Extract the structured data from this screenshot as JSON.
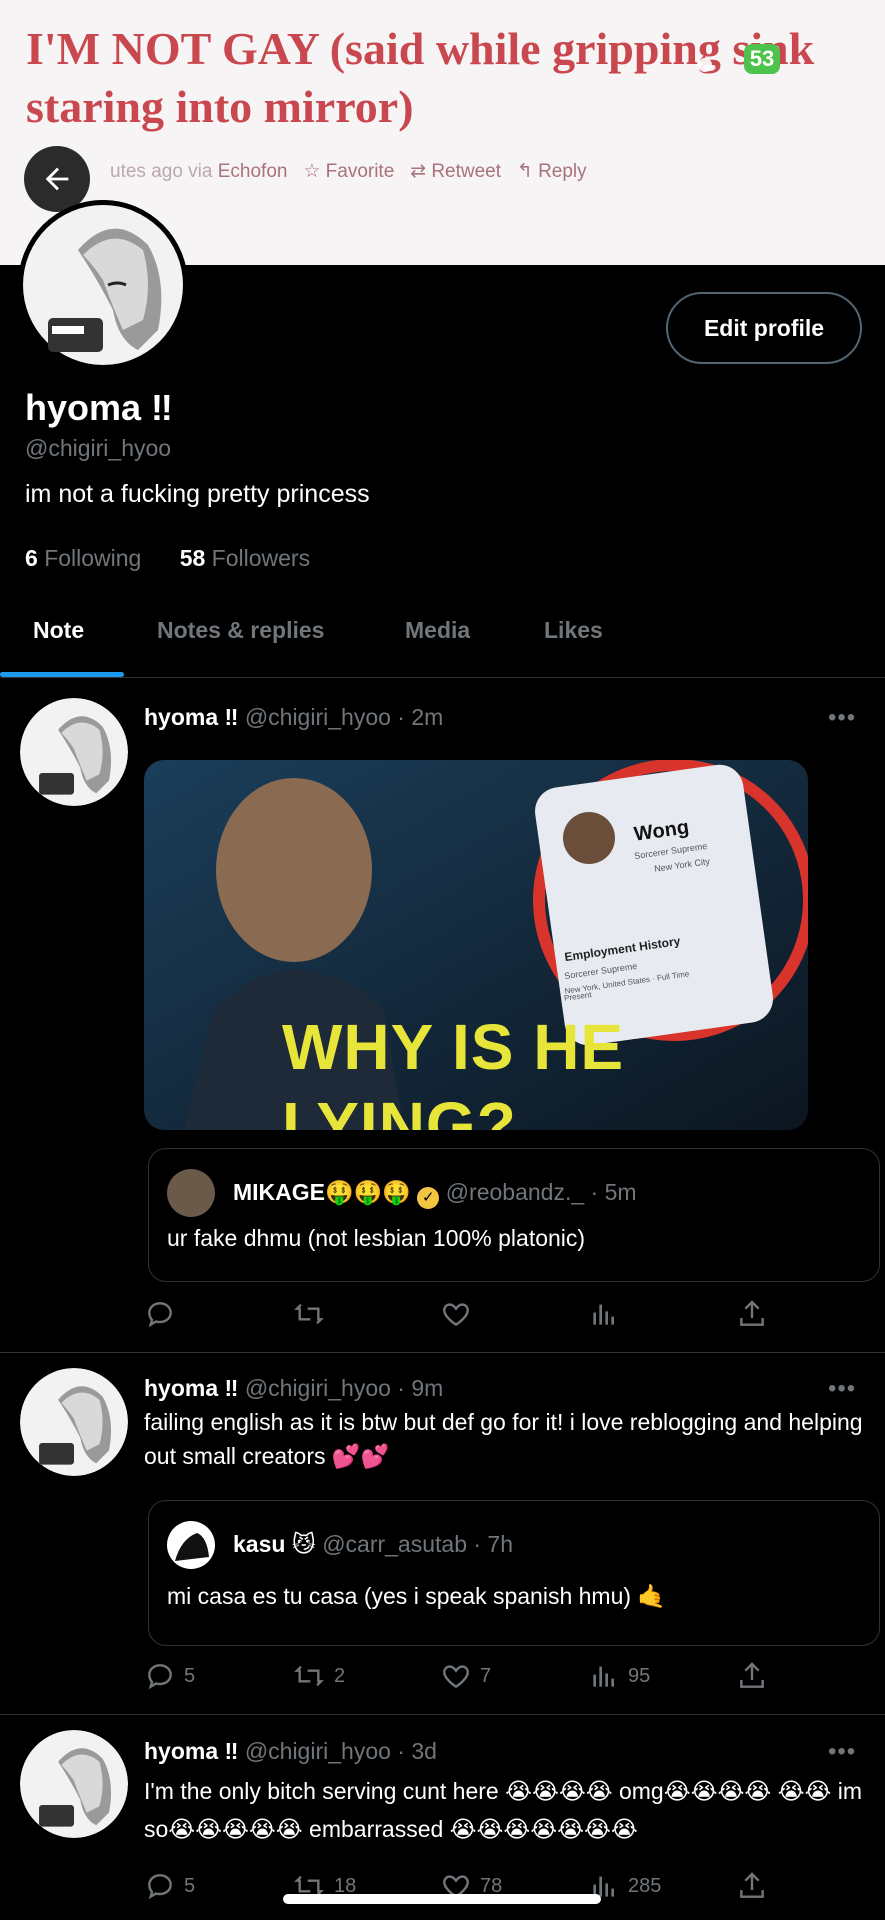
{
  "banner": {
    "title": "I'M NOT GAY (said while gripping sink staring into mirror)",
    "meta_time": "utes ago via",
    "meta_client": "Echofon",
    "meta_favorite": "☆ Favorite",
    "meta_retweet": "⇄ Retweet",
    "meta_reply": "↰ Reply",
    "battery": "53"
  },
  "profile": {
    "edit_label": "Edit profile",
    "name": "hyoma ‼",
    "handle": "@chigiri_hyoo",
    "bio": "im not a fucking pretty princess",
    "following_count": "6",
    "following_label": "Following",
    "followers_count": "58",
    "followers_label": "Followers"
  },
  "tabs": [
    "Note",
    "Notes & replies",
    "Media",
    "Likes"
  ],
  "tweets": [
    {
      "name": "hyoma ‼",
      "meta": "@chigiri_hyoo · 2m",
      "more": "•••",
      "media": {
        "caption_line1": "WHY IS HE",
        "caption_line2": "LYING?",
        "phone_name": "Wong",
        "phone_sub": "Sorcerer Supreme",
        "phone_loc": "New York City",
        "phone_section": "Employment History",
        "phone_job": "Sorcerer Supreme",
        "phone_job_loc": "New York, United States · Full Time",
        "phone_present": "Present"
      },
      "quote": {
        "name": "MIKAGE🤑🤑🤑",
        "meta": "@reobandz._ · 5m",
        "text": "ur fake dhmu (not lesbian 100% platonic)"
      },
      "stats": {
        "reply": "",
        "retweet": "",
        "like": "",
        "views": ""
      }
    },
    {
      "name": "hyoma ‼",
      "meta": "@chigiri_hyoo · 9m",
      "more": "•••",
      "text": "failing english as it is btw but def go for it! i love reblogging and helping out small creators 💕💕",
      "quote": {
        "name": "kasu 😼",
        "meta": "@carr_asutab · 7h",
        "text": "mi casa es tu casa (yes i speak spanish hmu) 🤙"
      },
      "stats": {
        "reply": "5",
        "retweet": "2",
        "like": "7",
        "views": "95"
      }
    },
    {
      "name": "hyoma ‼",
      "meta": "@chigiri_hyoo · 3d",
      "more": "•••",
      "text": "I'm the only bitch serving cunt here 😭😭😭😭 omg😭😭😭😭 😭😭 im so😭😭😭😭😭 embarrassed 😭😭😭😭😭😭😭",
      "stats": {
        "reply": "5",
        "retweet": "18",
        "like": "78",
        "views": "285"
      }
    }
  ],
  "colors": {
    "accent": "#1d9bf0",
    "banner_text": "#c9484f",
    "secondary_text": "#71767b",
    "verified": "#f4c542"
  }
}
